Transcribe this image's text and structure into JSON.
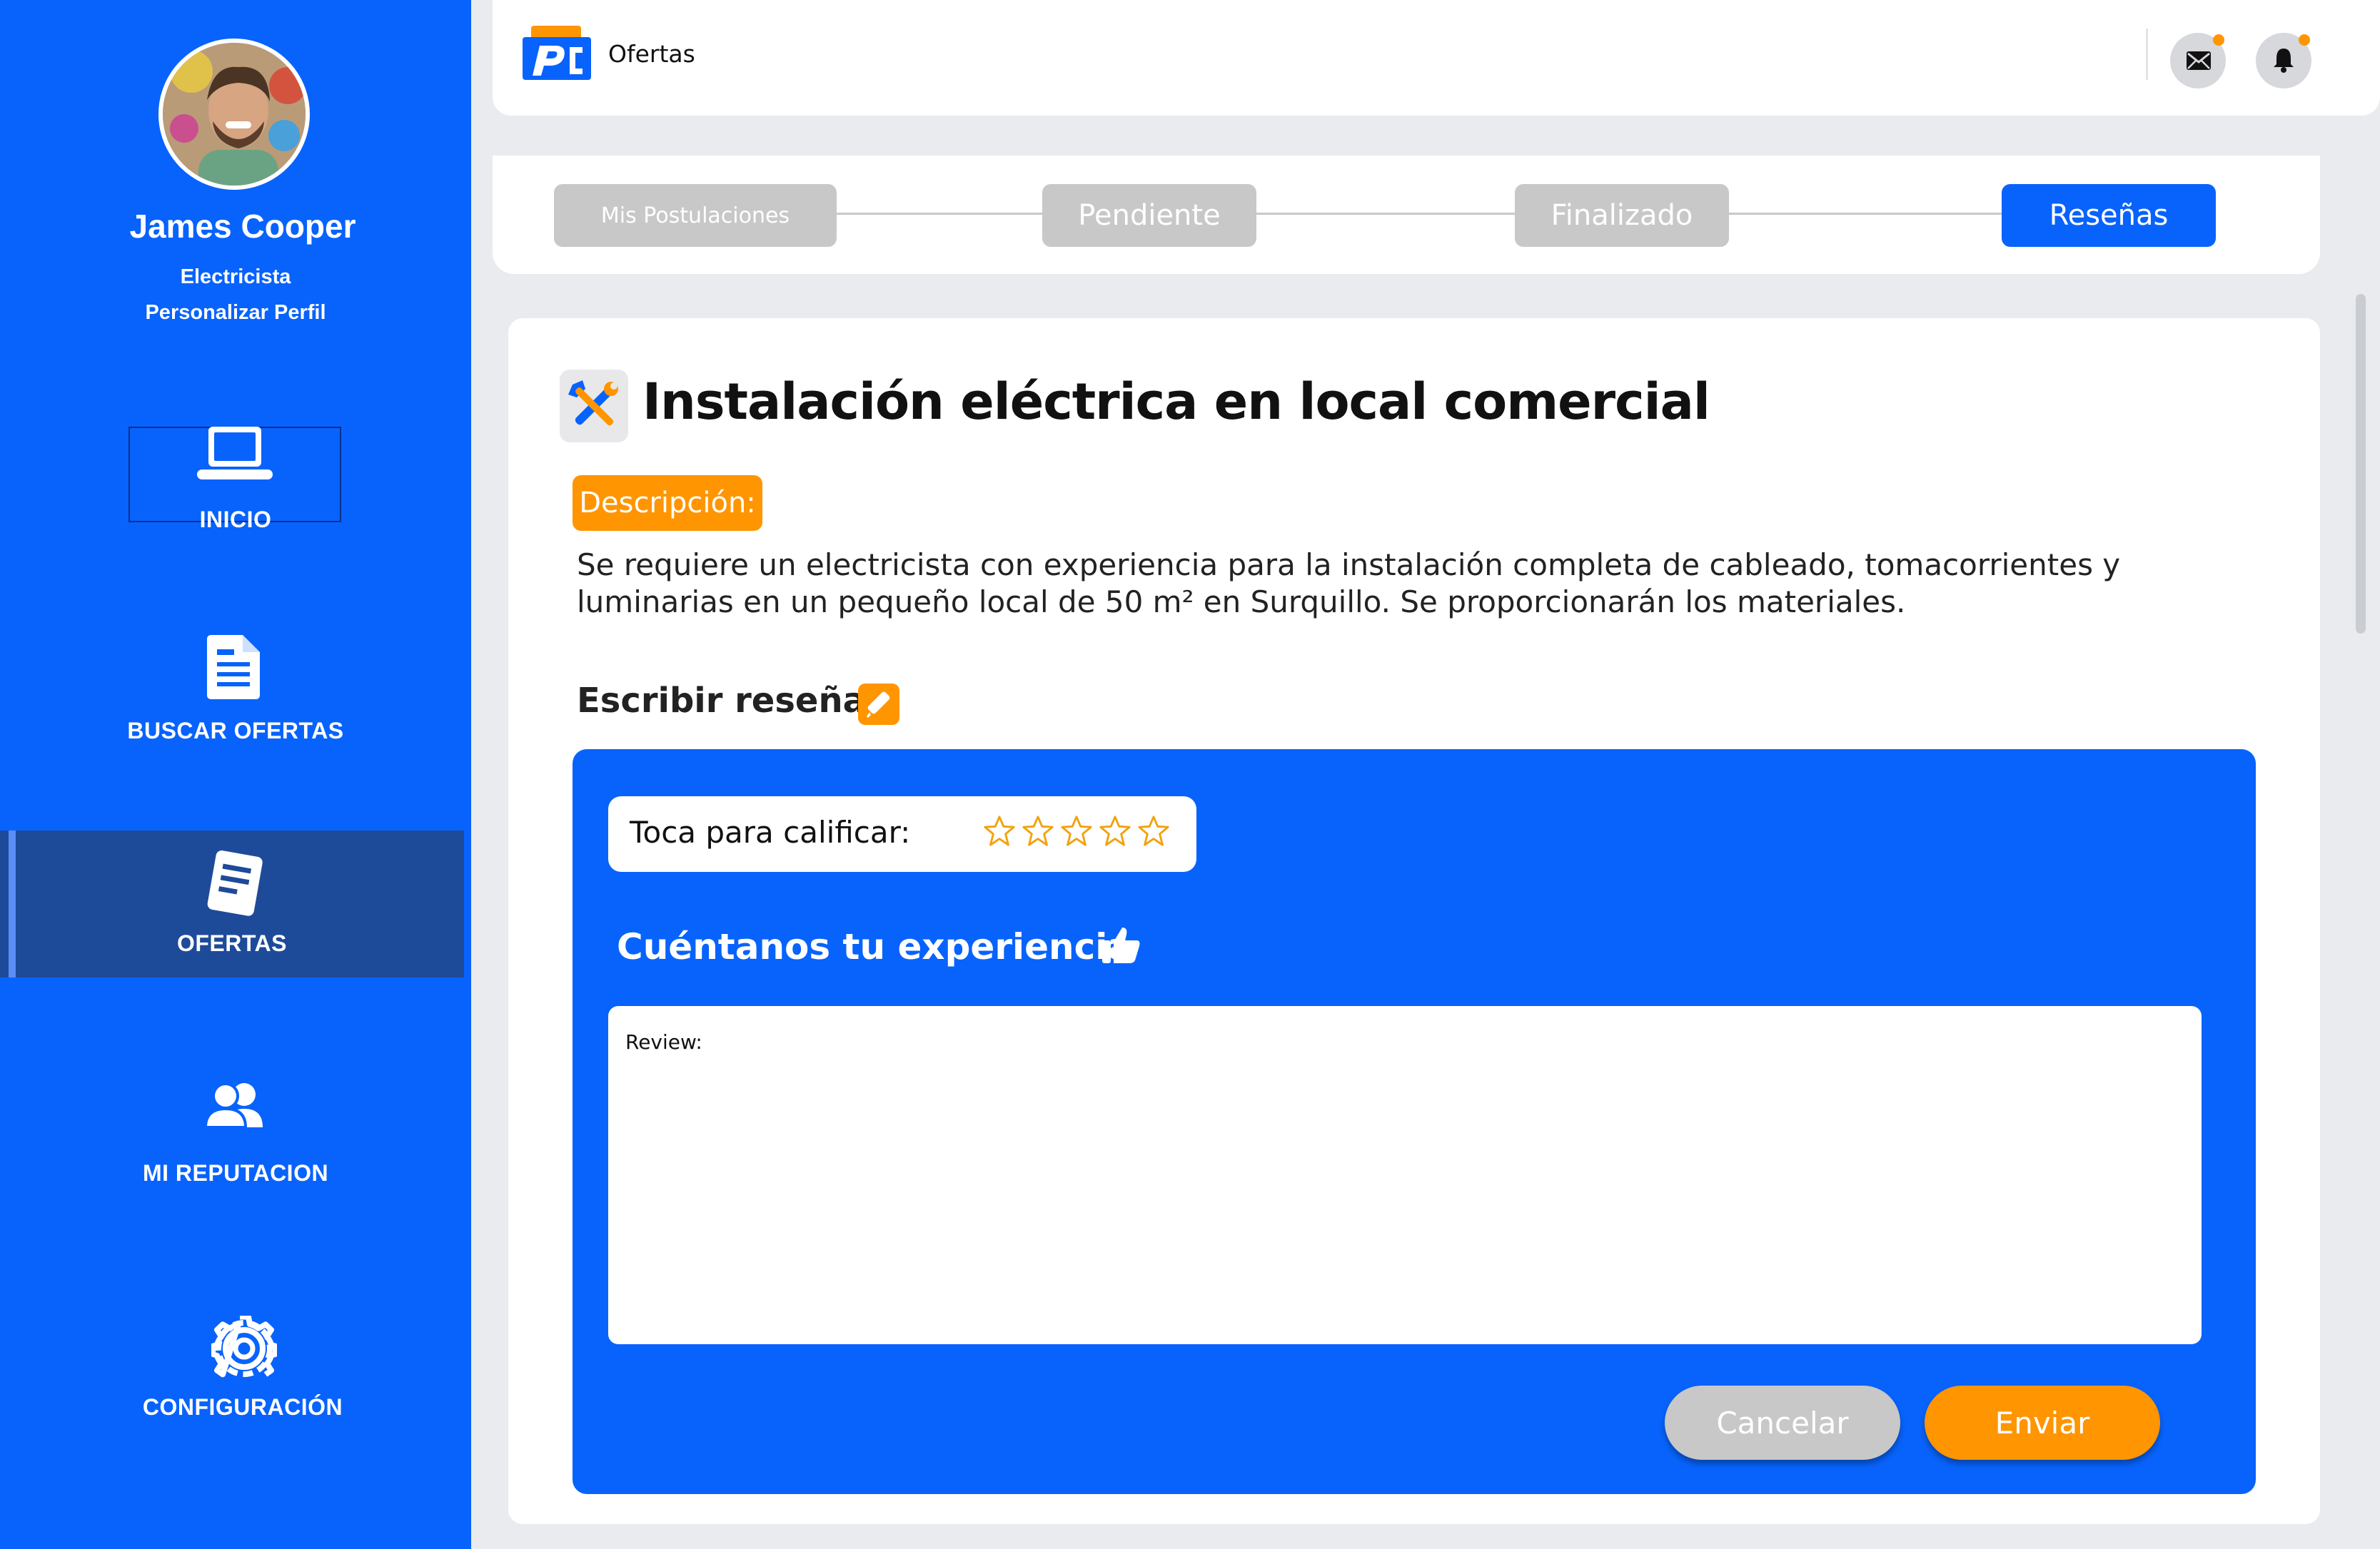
{
  "sidebar": {
    "user": {
      "name": "James Cooper",
      "role": "Electricista",
      "customize_link": "Personalizar Perfil"
    },
    "items": [
      {
        "label": "INICIO",
        "icon": "laptop-icon"
      },
      {
        "label": "BUSCAR OFERTAS",
        "icon": "document-icon"
      },
      {
        "label": "OFERTAS",
        "icon": "note-icon",
        "active": true
      },
      {
        "label": "MI REPUTACION",
        "icon": "users-icon"
      },
      {
        "label": "CONFIGURACIÓN",
        "icon": "gear-icon"
      }
    ]
  },
  "header": {
    "title": "Ofertas",
    "icons": [
      "mail-icon",
      "bell-icon"
    ],
    "notification_color": "#ff9500"
  },
  "steps": [
    {
      "label": "Mis Postulaciones",
      "state": "inactive"
    },
    {
      "label": "Pendiente",
      "state": "inactive"
    },
    {
      "label": "Finalizado",
      "state": "inactive"
    },
    {
      "label": "Reseñas",
      "state": "active"
    }
  ],
  "job": {
    "title": "Instalación eléctrica en local comercial",
    "description_label": "Descripción:",
    "description": "Se requiere un electricista con experiencia para la instalación completa de cableado, tomacorrientes y luminarias en un pequeño local de 50 m² en Surquillo. Se proporcionarán los materiales."
  },
  "review": {
    "heading": "Escribir reseña",
    "rate_label": "Toca para calificar:",
    "rating": 0,
    "rating_max": 5,
    "experience_heading": "Cuéntanos tu experiencia",
    "textarea_value": "Review:",
    "cancel_label": "Cancelar",
    "send_label": "Enviar"
  },
  "colors": {
    "primary": "#0863fc",
    "accent": "#ff9500",
    "sidebar_active": "#1e4a9a",
    "inactive": "#c8c8c8"
  }
}
